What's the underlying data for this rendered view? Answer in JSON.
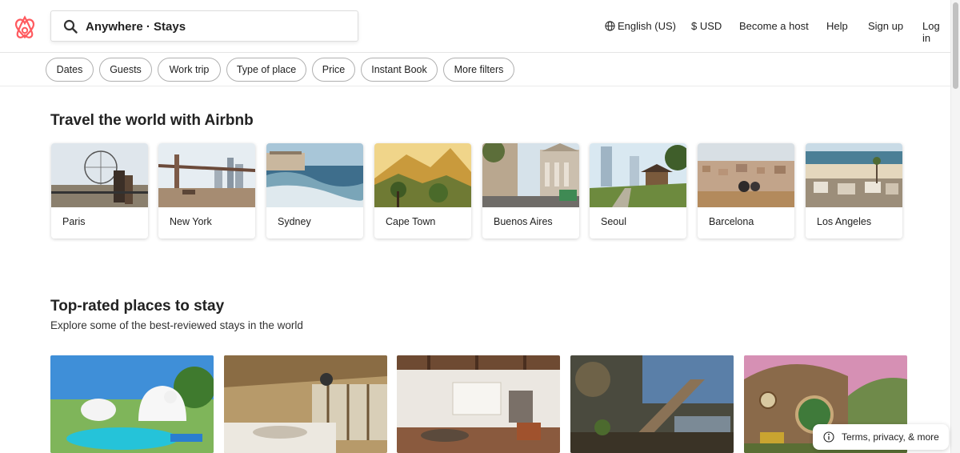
{
  "header": {
    "search_text": "Anywhere · Stays",
    "nav": {
      "language": "English (US)",
      "currency": "$ USD",
      "host": "Become a host",
      "help": "Help",
      "signup": "Sign up",
      "login": "Log in"
    }
  },
  "filters": [
    "Dates",
    "Guests",
    "Work trip",
    "Type of place",
    "Price",
    "Instant Book",
    "More filters"
  ],
  "destinations": {
    "title": "Travel the world with Airbnb",
    "cities": [
      "Paris",
      "New York",
      "Sydney",
      "Cape Town",
      "Buenos Aires",
      "Seoul",
      "Barcelona",
      "Los Angeles"
    ]
  },
  "top_rated": {
    "title": "Top-rated places to stay",
    "subtitle": "Explore some of the best-reviewed stays in the world"
  },
  "footer": {
    "terms": "Terms, privacy, & more"
  },
  "colors": {
    "brand": "#ff5a5f",
    "text": "#222222",
    "border": "#b0b0b0"
  },
  "icons": {
    "logo": "airbnb-logo-icon",
    "search": "search-icon",
    "globe": "globe-icon",
    "info": "info-icon"
  }
}
